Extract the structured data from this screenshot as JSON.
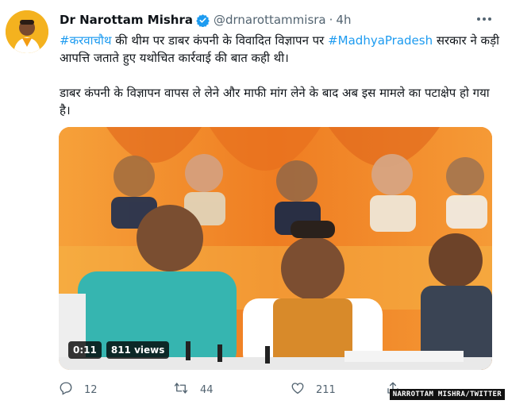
{
  "tweet": {
    "author_name": "Dr Narottam Mishra",
    "handle": "@drnarottammisra",
    "separator": "·",
    "time": "4h",
    "paragraph1": {
      "hashtag1": "#करवाचौथ",
      "text1": " की थीम पर डाबर कंपनी के विवादित विज्ञापन पर ",
      "hashtag2": "#MadhyaPradesh",
      "text2": " सरकार ने कड़ी आपत्ति जताते हुए यथोचित कार्रवाई की बात कही थी।"
    },
    "paragraph2": "डाबर कंपनी के विज्ञापन वापस ले लेने और माफी मांग लेने के बाद अब इस मामले का पटाक्षेप हो गया है।"
  },
  "video": {
    "duration": "0:11",
    "views": "811 views"
  },
  "actions": {
    "replies": "12",
    "retweets": "44",
    "likes": "211"
  },
  "credit": "NARROTTAM MISHRA/TWITTER",
  "icons": {
    "verified": "verified-badge-icon",
    "more": "more-options-icon",
    "reply": "reply-icon",
    "retweet": "retweet-icon",
    "like": "like-icon",
    "share": "share-icon"
  },
  "colors": {
    "accent": "#1d9bf0",
    "muted": "#536471",
    "text": "#0f1419"
  }
}
